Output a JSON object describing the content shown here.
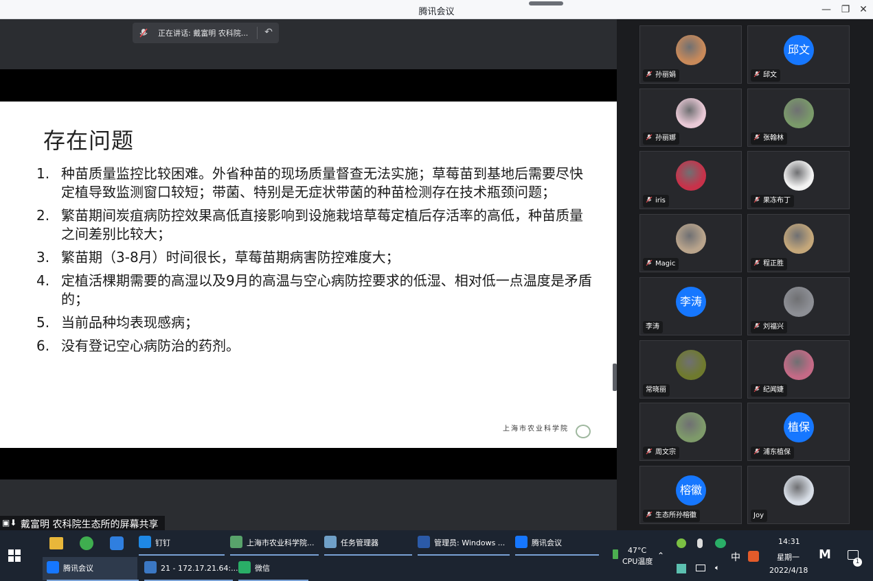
{
  "window": {
    "title": "腾讯会议",
    "minimize_icon": "—",
    "restore_icon": "❐",
    "close_icon": "✕"
  },
  "speaking": {
    "label": "正在讲话: 戴富明 农科院...",
    "back_icon": "↶"
  },
  "slide": {
    "title": "存在问题",
    "items": [
      {
        "num": "1.",
        "text": "种苗质量监控比较困难。外省种苗的现场质量督查无法实施；草莓苗到基地后需要尽快定植导致监测窗口较短；带菌、特别是无症状带菌的种苗检测存在技术瓶颈问题；"
      },
      {
        "num": "2.",
        "text": "繁苗期间炭疽病防控效果高低直接影响到设施栽培草莓定植后存活率的高低，种苗质量之间差别比较大；"
      },
      {
        "num": "3.",
        "text": "繁苗期（3-8月）时间很长，草莓苗期病害防控难度大；"
      },
      {
        "num": "4.",
        "text": "定植活棵期需要的高湿以及9月的高温与空心病防控要求的低湿、相对低一点温度是矛盾的；"
      },
      {
        "num": "5.",
        "text": "当前品种均表现感病；"
      },
      {
        "num": "6.",
        "text": "没有登记空心病防治的药剂。"
      }
    ],
    "footer_logo": "上海市农业科学院"
  },
  "share_bar": {
    "label": "戴富明 农科院生态所的屏幕共享"
  },
  "participants": [
    {
      "name": "孙丽娟",
      "avatar_type": "photo",
      "avatar_color": "#c98a5a"
    },
    {
      "name": "邱文",
      "avatar_type": "text",
      "avatar_text": "邱文"
    },
    {
      "name": "孙丽娜",
      "avatar_type": "photo",
      "avatar_color": "#e9c9d6"
    },
    {
      "name": "张翰林",
      "avatar_type": "photo",
      "avatar_color": "#7a9a6a"
    },
    {
      "name": "iris",
      "avatar_type": "photo",
      "avatar_color": "#c8324a"
    },
    {
      "name": "果冻布丁",
      "avatar_type": "photo",
      "avatar_color": "#f2f2f2"
    },
    {
      "name": "Magic",
      "avatar_type": "photo",
      "avatar_color": "#b9a48c"
    },
    {
      "name": "程正胜",
      "avatar_type": "photo",
      "avatar_color": "#c4a77a"
    },
    {
      "name": "李涛",
      "avatar_type": "text",
      "avatar_text": "李涛"
    },
    {
      "name": "刘福兴",
      "avatar_type": "photo",
      "avatar_color": "#8d8f95"
    },
    {
      "name": "常晓丽",
      "avatar_type": "photo",
      "avatar_color": "#6f7a2e"
    },
    {
      "name": "纪闻婕",
      "avatar_type": "photo",
      "avatar_color": "#c46a86"
    },
    {
      "name": "周文宗",
      "avatar_type": "photo",
      "avatar_color": "#7e9a6a"
    },
    {
      "name": "浦东植保",
      "avatar_type": "text",
      "avatar_text": "植保"
    },
    {
      "name": "生态所孙榕徽",
      "avatar_type": "text",
      "avatar_text": "榕徽"
    },
    {
      "name": "Joy",
      "avatar_type": "photo",
      "avatar_color": "#d7dde6"
    }
  ],
  "taskbar": {
    "row1": [
      {
        "label": "钉钉",
        "color": "#1e88e5"
      },
      {
        "label": "上海市农业科学院...",
        "color": "#58a36b"
      },
      {
        "label": "任务管理器",
        "color": "#6fa0c8"
      },
      {
        "label": "管理员: Windows ...",
        "color": "#2b5aa8"
      },
      {
        "label": "腾讯会议",
        "color": "#1677ff"
      }
    ],
    "row2": [
      {
        "label": "腾讯会议",
        "color": "#1677ff"
      },
      {
        "label": "21 - 172.17.21.64:...",
        "color": "#3b78c4"
      },
      {
        "label": "微信",
        "color": "#2aae67"
      }
    ],
    "temperature": "47°C",
    "temperature_label": "CPU温度",
    "ime": "中",
    "time": "14:31",
    "weekday": "星期一",
    "date": "2022/4/18",
    "notification_count": "1"
  }
}
